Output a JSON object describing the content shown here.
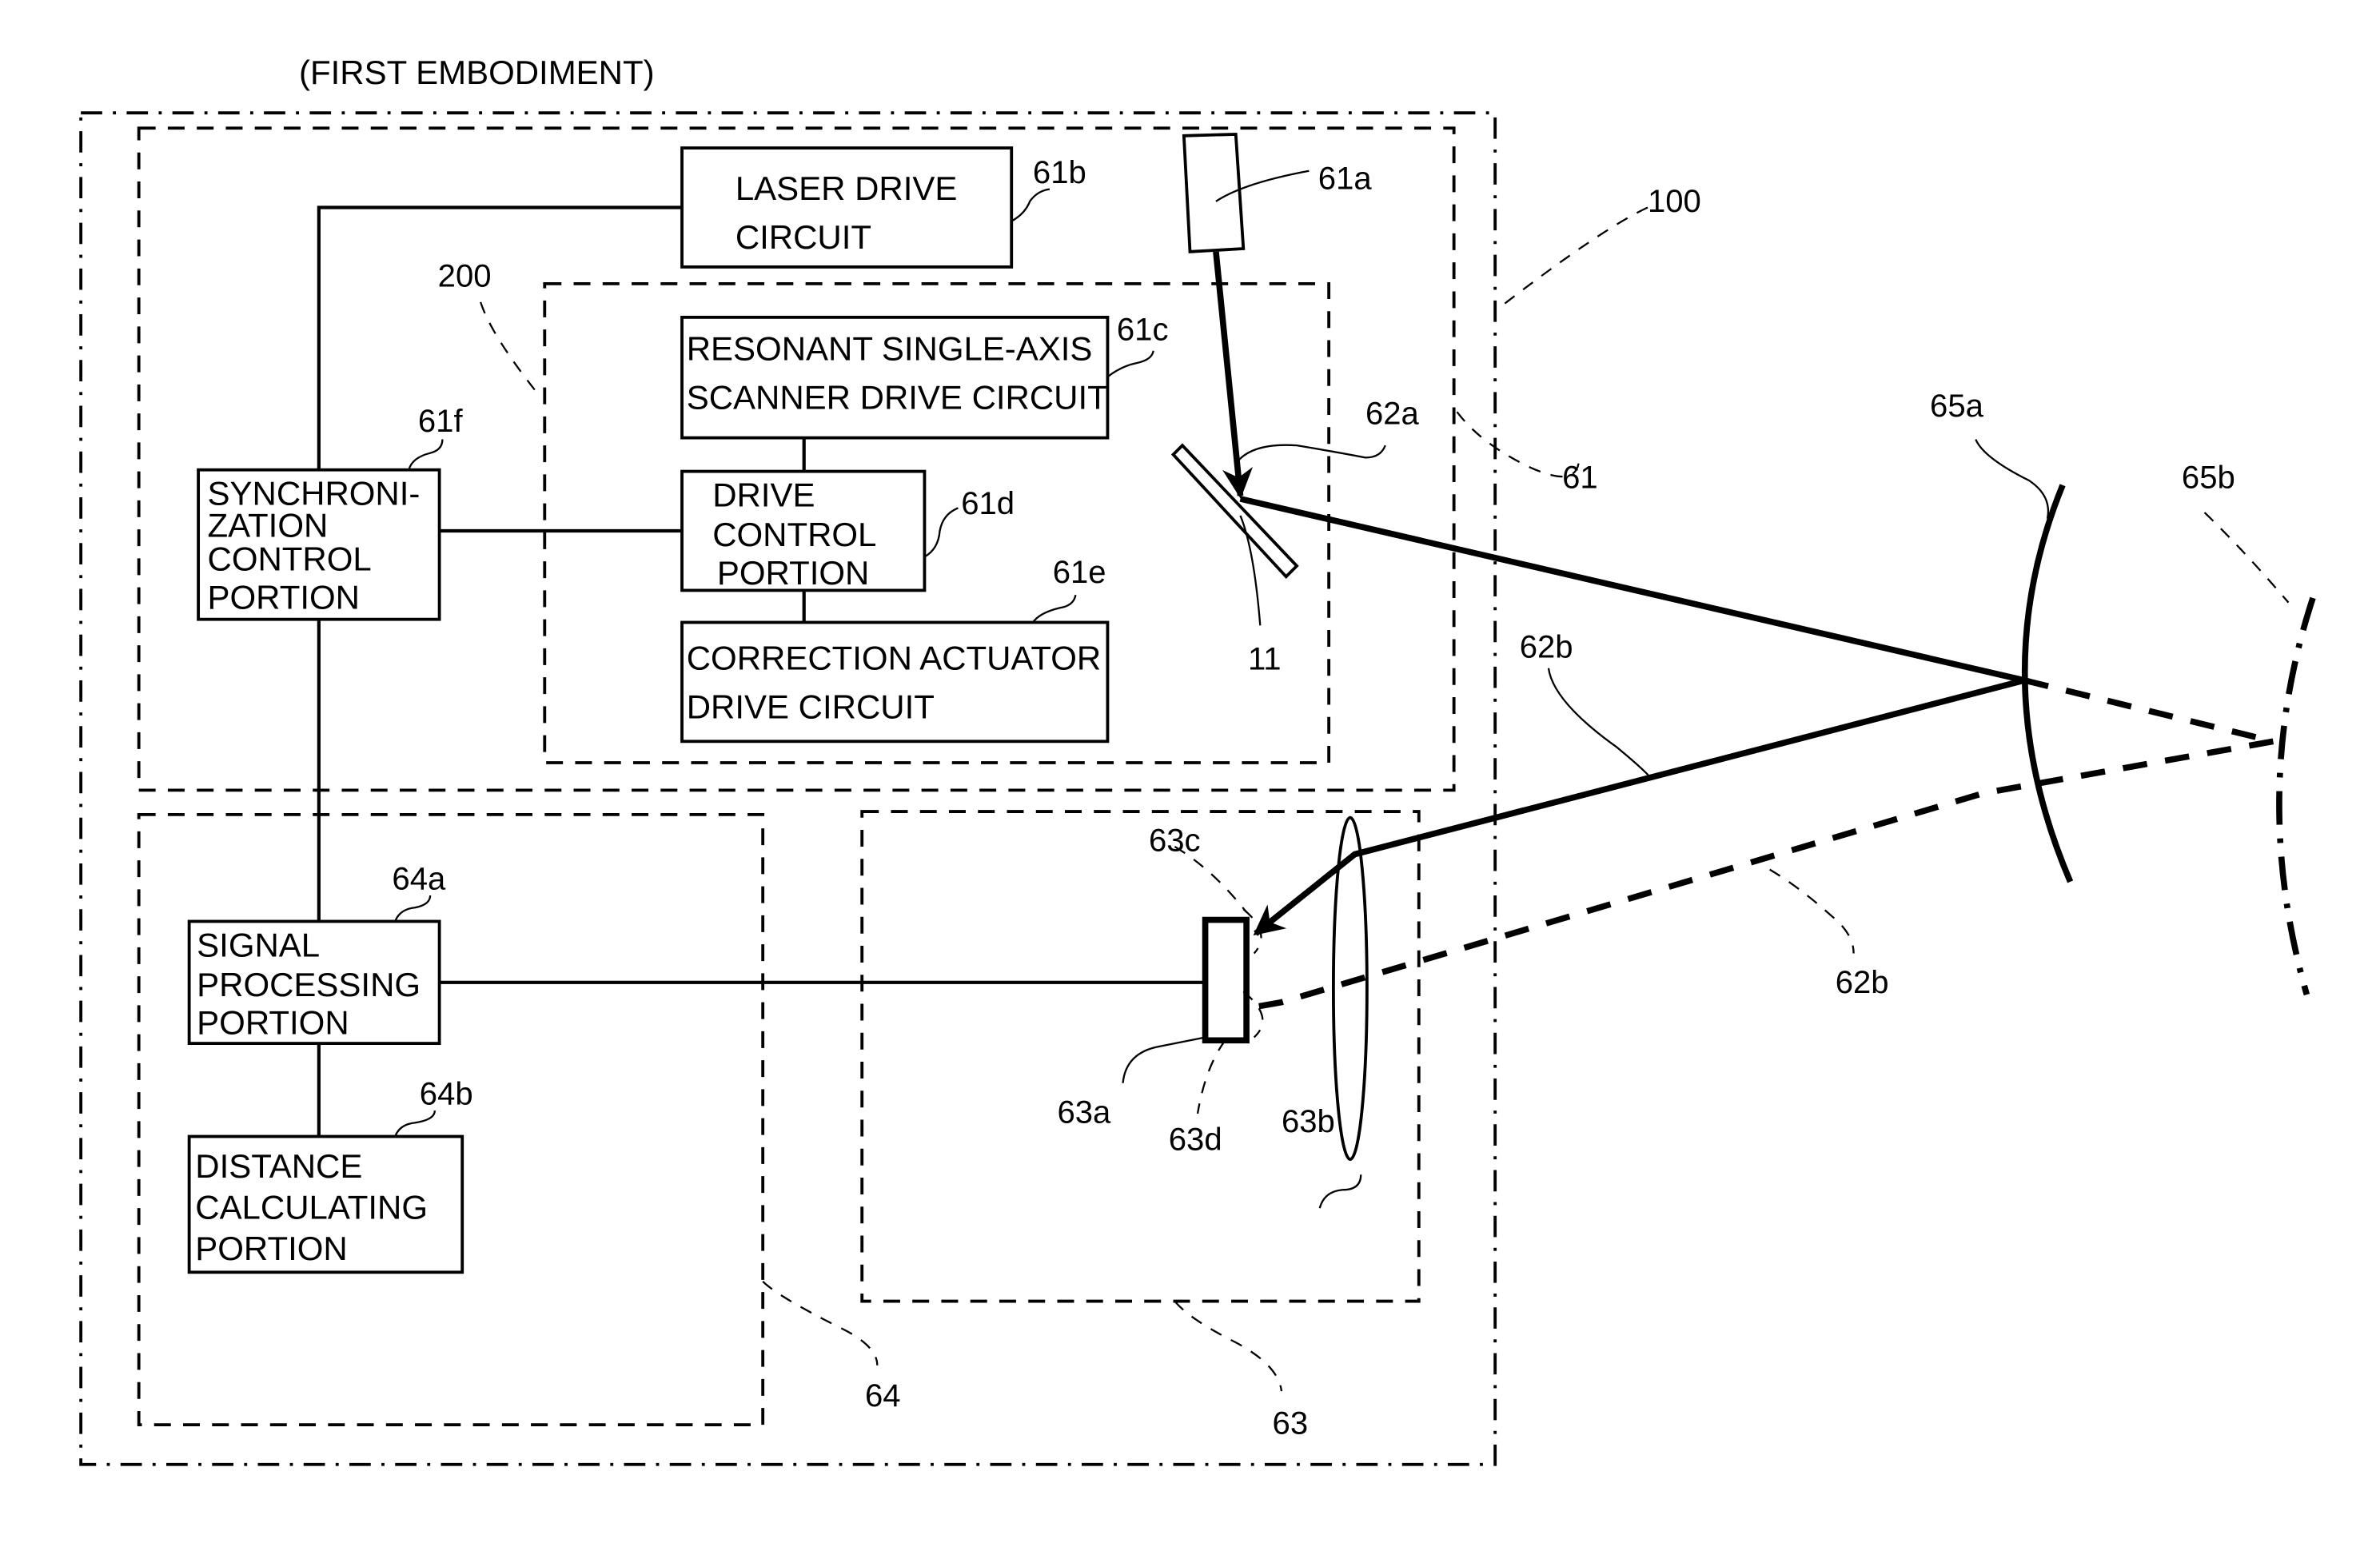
{
  "title": "(FIRST EMBODIMENT)",
  "blocks": {
    "laser_drive": [
      "LASER DRIVE",
      "CIRCUIT"
    ],
    "scanner_drive": [
      "RESONANT SINGLE-AXIS",
      "SCANNER DRIVE CIRCUIT"
    ],
    "drive_control": [
      "DRIVE",
      "CONTROL",
      "PORTION"
    ],
    "correction_actuator": [
      "CORRECTION ACTUATOR",
      "DRIVE CIRCUIT"
    ],
    "sync_control": [
      "SYNCHRONI-",
      "ZATION",
      "CONTROL",
      "PORTION"
    ],
    "signal_processing": [
      "SIGNAL",
      "PROCESSING",
      "PORTION"
    ],
    "distance_calc": [
      "DISTANCE",
      "CALCULATING",
      "PORTION"
    ]
  },
  "refs": {
    "r100": "100",
    "r200": "200",
    "r61": "61",
    "r61a": "61a",
    "r61b": "61b",
    "r61c": "61c",
    "r61d": "61d",
    "r61e": "61e",
    "r61f": "61f",
    "r62a": "62a",
    "r62b_top": "62b",
    "r62b_bottom": "62b",
    "r11": "11",
    "r63": "63",
    "r63a": "63a",
    "r63b": "63b",
    "r63c": "63c",
    "r63d": "63d",
    "r64": "64",
    "r64a": "64a",
    "r64b": "64b",
    "r65a": "65a",
    "r65b": "65b"
  }
}
